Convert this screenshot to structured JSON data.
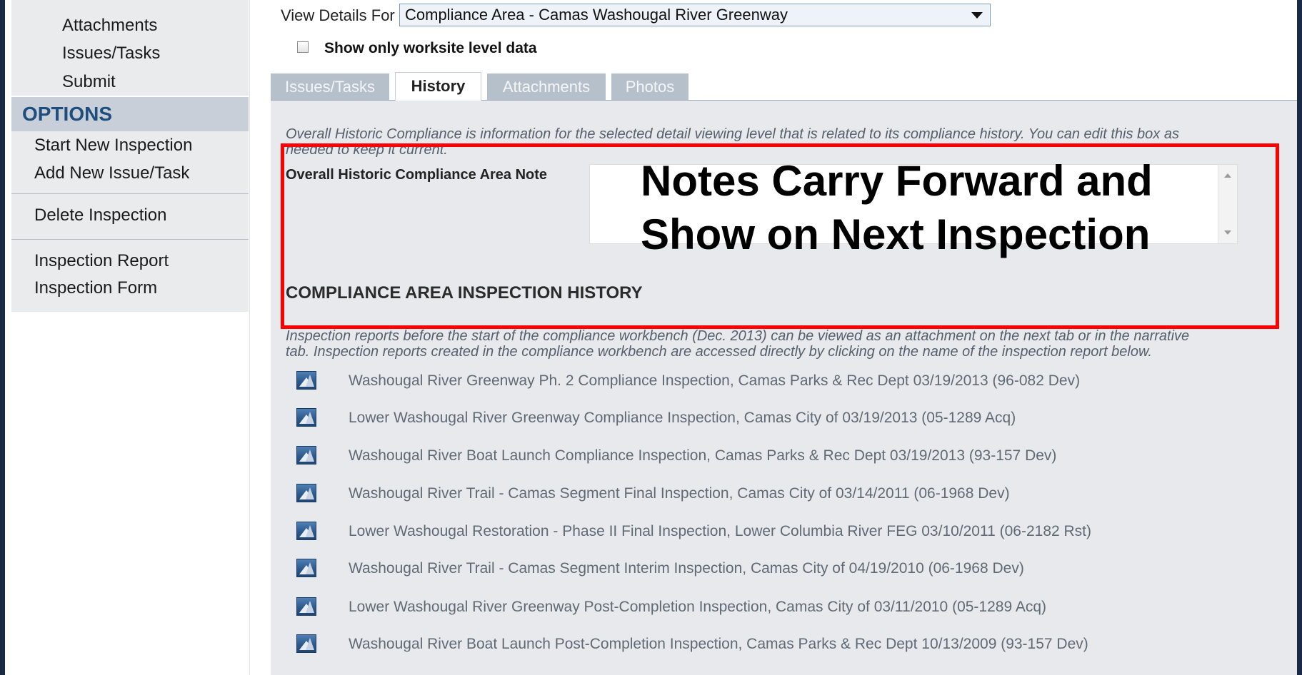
{
  "sidebar": {
    "nav_items": [
      "Attachments",
      "Issues/Tasks",
      "Submit"
    ],
    "options_title": "OPTIONS",
    "options_items": [
      "Start New Inspection",
      "Add New Issue/Task",
      "Delete Inspection",
      "Inspection Report",
      "Inspection Form"
    ]
  },
  "view": {
    "label": "View Details For",
    "selected": "Compliance Area - Camas Washougal River Greenway"
  },
  "worksite": {
    "label": "Show only worksite level data",
    "checked": false
  },
  "tabs": [
    {
      "label": "Issues/Tasks",
      "active": false
    },
    {
      "label": "History",
      "active": true
    },
    {
      "label": "Attachments",
      "active": false
    },
    {
      "label": "Photos",
      "active": false
    }
  ],
  "history": {
    "intro_line1": "Overall Historic Compliance is information for the selected detail viewing level that is related to its compliance history. You can edit this box as",
    "intro_line2": "needed to keep it current.",
    "note_label": "Overall Historic Compliance Area Note",
    "note_value": "",
    "heading": "COMPLIANCE AREA INSPECTION HISTORY",
    "reports_line1": "Inspection reports before the start of the compliance workbench (Dec. 2013) can be viewed as an attachment on the next tab or in the narrative",
    "reports_line2": "tab. Inspection reports created in the compliance workbench are accessed directly by clicking on the name of the inspection report below.",
    "reports": [
      "Washougal River Greenway Ph. 2 Compliance Inspection, Camas Parks & Rec Dept 03/19/2013 (96-082 Dev)",
      "Lower Washougal River Greenway Compliance Inspection, Camas City of 03/19/2013 (05-1289 Acq)",
      "Washougal River Boat Launch Compliance Inspection, Camas Parks & Rec Dept 03/19/2013 (93-157 Dev)",
      "Washougal River Trail - Camas Segment Final Inspection, Camas City of 03/14/2011 (06-1968 Dev)",
      "Lower Washougal Restoration - Phase II Final Inspection, Lower Columbia River FEG 03/10/2011 (06-2182 Rst)",
      "Washougal River Trail - Camas Segment Interim Inspection, Camas City of 04/19/2010 (06-1968 Dev)",
      "Lower Washougal River Greenway Post-Completion Inspection, Camas City of 03/11/2010 (05-1289 Acq)",
      "Washougal River Boat Launch Post-Completion Inspection, Camas Parks & Rec Dept 10/13/2009 (93-157 Dev)"
    ]
  },
  "callout": {
    "line1": "Notes Carry Forward and",
    "line2": "Show on Next Inspection",
    "color": "#ff0000"
  }
}
